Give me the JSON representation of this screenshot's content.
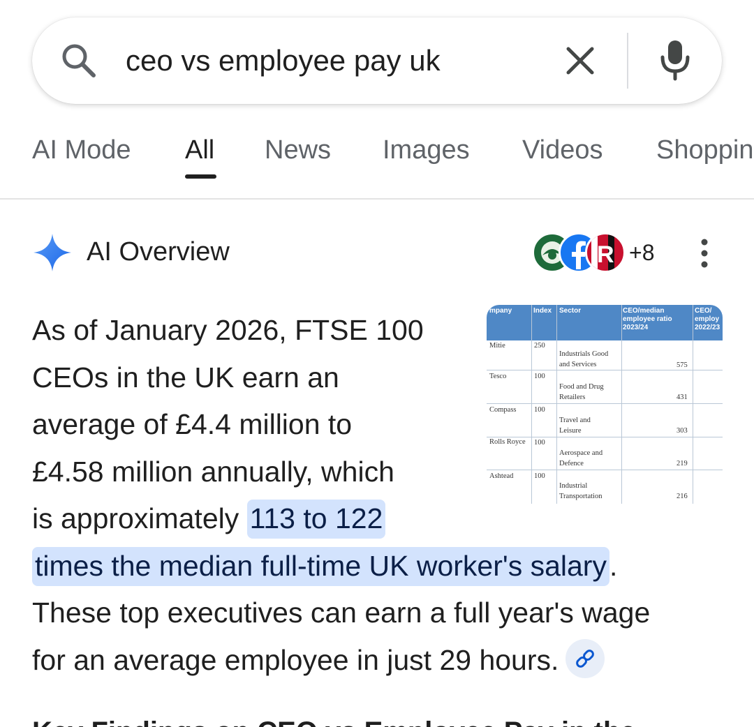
{
  "search": {
    "query": "ceo vs employee pay uk"
  },
  "tabs": [
    {
      "label": "AI Mode"
    },
    {
      "label": "All"
    },
    {
      "label": "News"
    },
    {
      "label": "Images"
    },
    {
      "label": "Videos"
    },
    {
      "label": "Shoppin"
    }
  ],
  "ai_overview": {
    "title": "AI Overview",
    "more_sources": "+8",
    "lines": [
      "As of January 2026, FTSE 100",
      "CEOs in the UK earn an",
      "average of £4.4 million to",
      "£4.58 million annually, which",
      "is approximately ",
      "113 to 122",
      "times the median full-time UK worker's salary",
      ".",
      "These top executives can earn a full year's wage",
      "for an average employee in just 29 hours."
    ],
    "next_heading": "Key Findings on CEO vs Employee Pay in the"
  },
  "thumbnail": {
    "headers": [
      "mpany",
      "Index",
      "Sector",
      "CEO/median employee ratio 2023/24",
      "CEO/ employ 2022/23"
    ],
    "rows": [
      {
        "company": "Mitie",
        "index": "250",
        "sector": [
          "Industrials Good",
          "and Services"
        ],
        "ratio": "575"
      },
      {
        "company": "Tesco",
        "index": "100",
        "sector": [
          "Food and Drug",
          "Retailers"
        ],
        "ratio": "431"
      },
      {
        "company": "Compass",
        "index": "100",
        "sector": [
          "Travel and",
          "Leisure"
        ],
        "ratio": "303"
      },
      {
        "company": "Rolls Royce",
        "index": "100",
        "sector": [
          "Aerospace and",
          "Defence"
        ],
        "ratio": "219"
      },
      {
        "company": "Ashtead",
        "index": "100",
        "sector": [
          "Industrial",
          "Transportation"
        ],
        "ratio": "216"
      }
    ]
  },
  "colors": {
    "highlight_bg": "#d3e3fd",
    "highlight_text": "#0b1f47",
    "sparkle": "#4285f4"
  }
}
